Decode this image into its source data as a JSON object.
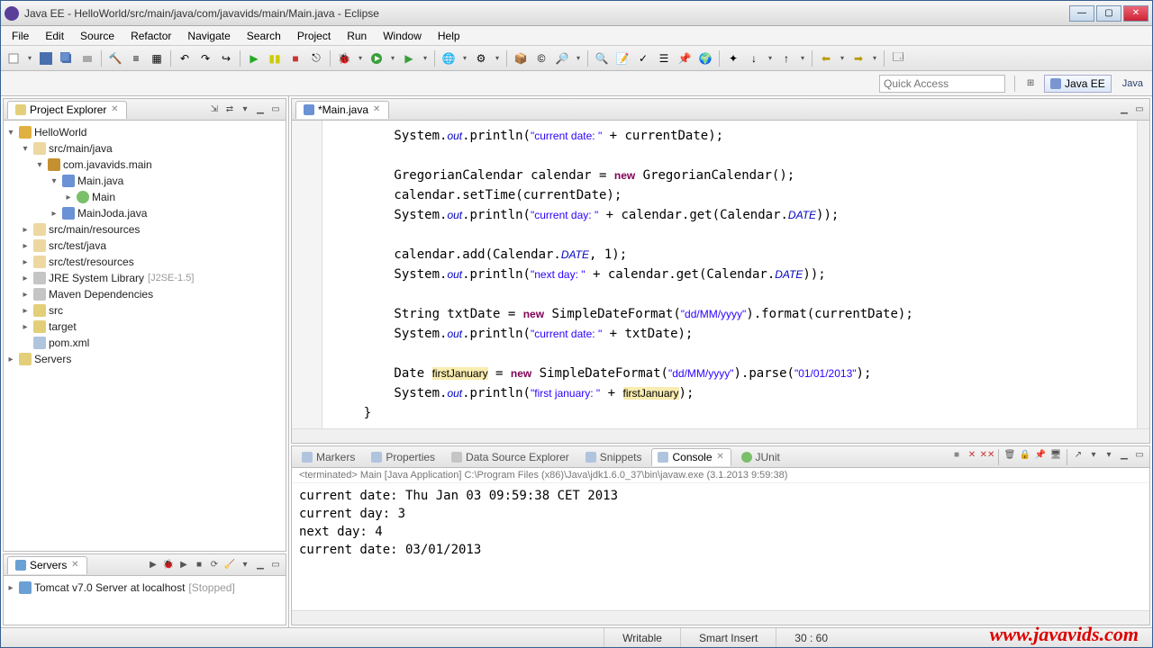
{
  "window": {
    "title": "Java EE - HelloWorld/src/main/java/com/javavids/main/Main.java - Eclipse"
  },
  "menu": [
    "File",
    "Edit",
    "Source",
    "Refactor",
    "Navigate",
    "Search",
    "Project",
    "Run",
    "Window",
    "Help"
  ],
  "quick_access": {
    "placeholder": "Quick Access"
  },
  "perspectives": {
    "active": "Java EE",
    "other": "Java"
  },
  "project_explorer": {
    "title": "Project Explorer",
    "tree": {
      "project": "HelloWorld",
      "src_main_java": "src/main/java",
      "package": "com.javavids.main",
      "main_java": "Main.java",
      "main_class": "Main",
      "mainjoda_java": "MainJoda.java",
      "src_main_res": "src/main/resources",
      "src_test_java": "src/test/java",
      "src_test_res": "src/test/resources",
      "jre_lib": "JRE System Library",
      "jre_hint": "[J2SE-1.5]",
      "maven_deps": "Maven Dependencies",
      "src_folder": "src",
      "target_folder": "target",
      "pom": "pom.xml",
      "servers_node": "Servers"
    }
  },
  "servers_view": {
    "title": "Servers",
    "server": "Tomcat v7.0 Server at localhost",
    "state": "[Stopped]"
  },
  "editor": {
    "tab": "*Main.java",
    "code_html": "        System.<span class='fld'>out</span>.println(<span class='str'>\"current date: \"</span> + currentDate);\n\n        GregorianCalendar calendar = <span class='kw'>new</span> GregorianCalendar();\n        calendar.setTime(currentDate);\n        System.<span class='fld'>out</span>.println(<span class='str'>\"current day: \"</span> + calendar.get(Calendar.<span class='fld'>DATE</span>));\n\n        calendar.add(Calendar.<span class='fld'>DATE</span>, 1);\n        System.<span class='fld'>out</span>.println(<span class='str'>\"next day: \"</span> + calendar.get(Calendar.<span class='fld'>DATE</span>));\n\n        String txtDate = <span class='kw'>new</span> SimpleDateFormat(<span class='str'>\"dd/MM/yyyy\"</span>).format(currentDate);\n        System.<span class='fld'>out</span>.println(<span class='str'>\"current date: \"</span> + txtDate);\n\n        Date <span class='hl'>firstJanuary</span> = <span class='kw'>new</span> SimpleDateFormat(<span class='str'>\"dd/MM/yyyy\"</span>).parse(<span class='str'>\"01/01/2013\"</span>);\n        System.<span class='fld'>out</span>.println(<span class='str'>\"first january: \"</span> + <span class='hl'>firstJanuary</span>);\n    }"
  },
  "bottom_tabs": {
    "markers": "Markers",
    "properties": "Properties",
    "dse": "Data Source Explorer",
    "snippets": "Snippets",
    "console": "Console",
    "junit": "JUnit"
  },
  "console": {
    "meta": "<terminated> Main [Java Application] C:\\Program Files (x86)\\Java\\jdk1.6.0_37\\bin\\javaw.exe (3.1.2013 9:59:38)",
    "output": "current date: Thu Jan 03 09:59:38 CET 2013\ncurrent day: 3\nnext day: 4\ncurrent date: 03/01/2013"
  },
  "status": {
    "writable": "Writable",
    "insert": "Smart Insert",
    "pos": "30 : 60"
  },
  "watermark": "www.javavids.com"
}
